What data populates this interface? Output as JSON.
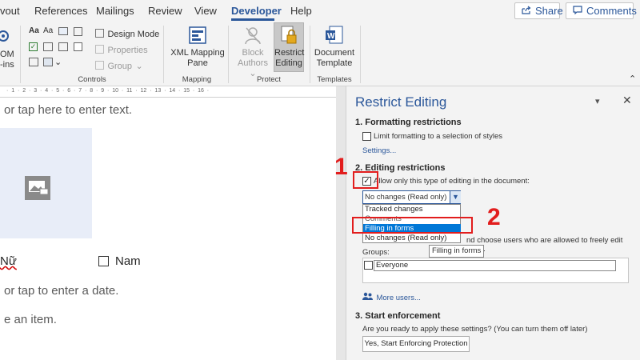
{
  "ribbon": {
    "tabs": [
      "vout",
      "References",
      "Mailings",
      "Review",
      "View",
      "Developer",
      "Help"
    ],
    "share_label": "Share",
    "comments_label": "Comments",
    "addins_partial_1": "OM",
    "addins_partial_2": "-ins",
    "controls": {
      "design_mode": "Design Mode",
      "properties": "Properties",
      "group": "Group",
      "label": "Controls"
    },
    "mapping": {
      "xml_mapping_pane_1": "XML Mapping",
      "xml_mapping_pane_2": "Pane",
      "label": "Mapping"
    },
    "protect": {
      "block_authors_1": "Block",
      "block_authors_2": "Authors",
      "restrict_editing_1": "Restrict",
      "restrict_editing_2": "Editing",
      "label": "Protect"
    },
    "templates": {
      "document_template_1": "Document",
      "document_template_2": "Template",
      "label": "Templates"
    }
  },
  "document": {
    "line1": "or tap here to enter text.",
    "checkbox_female": "Nữ",
    "checkbox_male": "Nam",
    "line_date": "or tap to enter a date.",
    "line_item": "e an item."
  },
  "pane": {
    "title": "Restrict Editing",
    "s1_title": "1. Formatting restrictions",
    "s1_checkbox": "Limit formatting to a selection of styles",
    "s1_settings": "Settings...",
    "s2_title": "2. Editing restrictions",
    "s2_checkbox": "Allow only this type of editing in the document:",
    "s2_selected": "No changes (Read only)",
    "s2_options": [
      "Tracked changes",
      "Comments",
      "Filling in forms",
      "No changes (Read only)"
    ],
    "s2_exceptions_text": "nd choose users who are allowed to freely edit them.",
    "tooltip": "Filling in forms",
    "groups_label": "Groups:",
    "group_everyone": "Everyone",
    "more_users": "More users...",
    "s3_title": "3. Start enforcement",
    "s3_question": "Are you ready to apply these settings? (You can turn them off later)",
    "s3_button": "Yes, Start Enforcing Protection"
  },
  "annotations": {
    "step1": "1",
    "step2": "2"
  },
  "colors": {
    "accent": "#2b579a",
    "highlight": "#0078d7",
    "annotation_red": "#e21d1d"
  }
}
